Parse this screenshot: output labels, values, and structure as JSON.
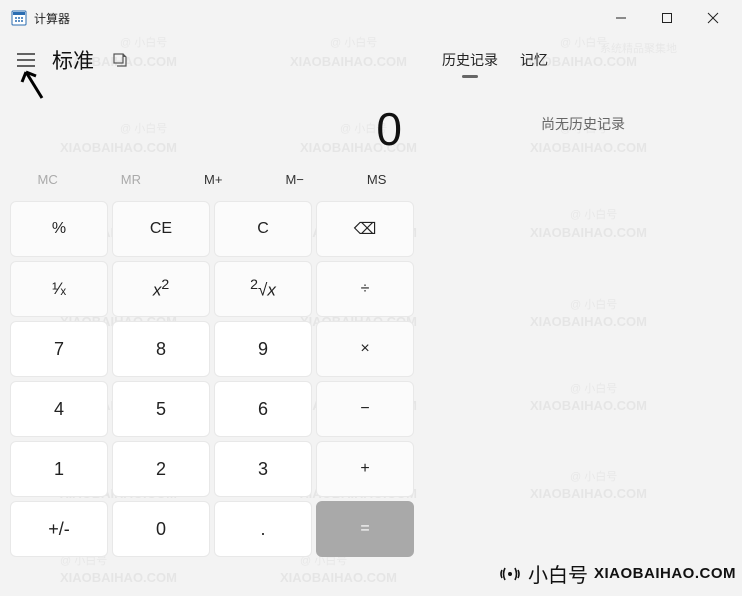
{
  "window": {
    "title": "计算器",
    "min": "—",
    "max": "☐",
    "close": "✕"
  },
  "header": {
    "mode": "标准"
  },
  "tabs": {
    "history": "历史记录",
    "memory": "记忆"
  },
  "history": {
    "empty": "尚无历史记录"
  },
  "display": {
    "value": "0"
  },
  "memory": {
    "mc": "MC",
    "mr": "MR",
    "mplus": "M+",
    "mminus": "M−",
    "ms": "MS"
  },
  "keys": {
    "percent": "%",
    "ce": "CE",
    "c": "C",
    "back": "⌫",
    "inv": "¹⁄ₓ",
    "sq": "x²",
    "sqrt": "²√x",
    "div": "÷",
    "7": "7",
    "8": "8",
    "9": "9",
    "mul": "×",
    "4": "4",
    "5": "5",
    "6": "6",
    "sub": "−",
    "1": "1",
    "2": "2",
    "3": "3",
    "add": "+",
    "neg": "+/-",
    "0": "0",
    "dot": ".",
    "eq": "="
  },
  "branding": {
    "cn": "小白号",
    "en": "XIAOBAIHAO.COM"
  },
  "watermark": {
    "a": "@ 小白号",
    "b": "XIAOBAIHAO.COM",
    "c": "系统精品聚集地"
  }
}
